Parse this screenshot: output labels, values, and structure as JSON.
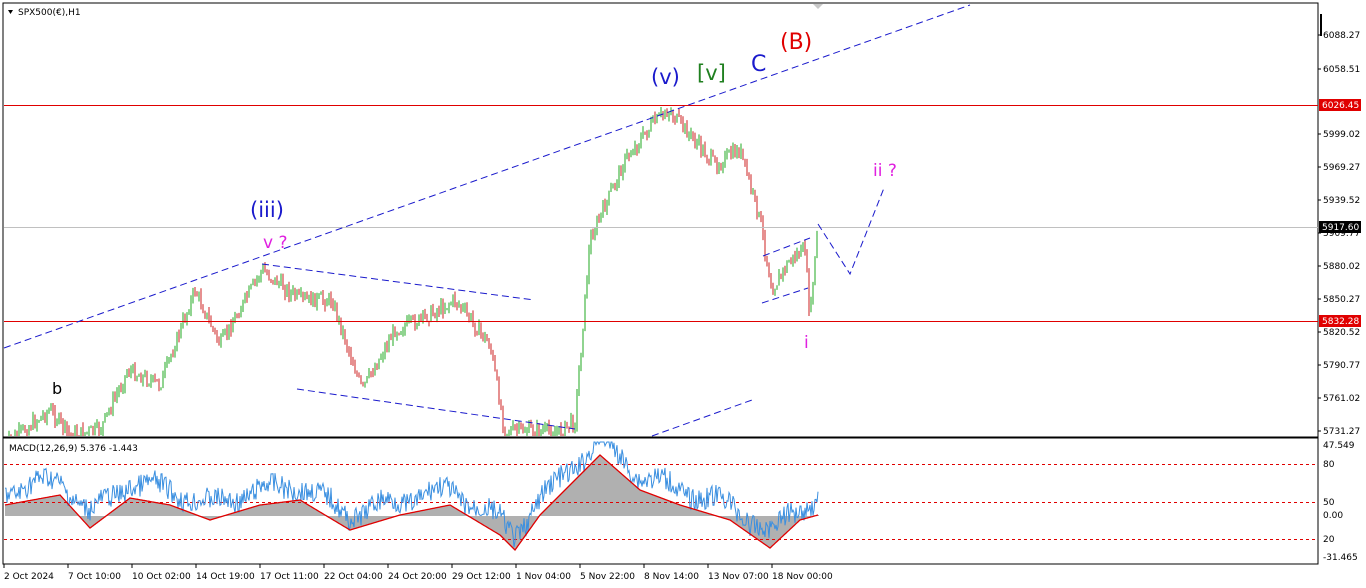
{
  "symbol_title": "SPX500(€),H1",
  "colors": {
    "up_candle": "#22aa22",
    "down_candle": "#cc2222",
    "hline": "#e00000",
    "trend": "#1a1acc",
    "macd_line": "#3a8fe0",
    "signal_line": "#e00000",
    "histogram": "#b0b0b0"
  },
  "price_axis": {
    "labels": [
      "6088.27",
      "6058.51",
      "5999.02",
      "5969.27",
      "5939.52",
      "5909.77",
      "5880.02",
      "5850.27",
      "5820.52",
      "5790.77",
      "5761.02",
      "5731.27"
    ],
    "tags": {
      "upper": "6026.45",
      "current": "5917.60",
      "lower": "5832.28"
    }
  },
  "time_axis": [
    "2 Oct 2024",
    "7 Oct 10:00",
    "10 Oct 02:00",
    "14 Oct 19:00",
    "17 Oct 11:00",
    "22 Oct 04:00",
    "24 Oct 20:00",
    "29 Oct 12:00",
    "1 Nov 04:00",
    "5 Nov 22:00",
    "8 Nov 14:00",
    "13 Nov 07:00",
    "18 Nov 00:00"
  ],
  "wave_labels": {
    "b": "b",
    "iii": "(iii)",
    "v_q": "v ?",
    "v_paren": "(v)",
    "v_bracket": "[v]",
    "C": "C",
    "B": "(B)",
    "ii_q": "ii ?",
    "i": "i"
  },
  "macd": {
    "title": "MACD(12,26,9) 5.376 -1.443",
    "axis_labels": [
      "47.549",
      "80",
      "50",
      "0.00",
      "20",
      "-31.465"
    ]
  }
}
